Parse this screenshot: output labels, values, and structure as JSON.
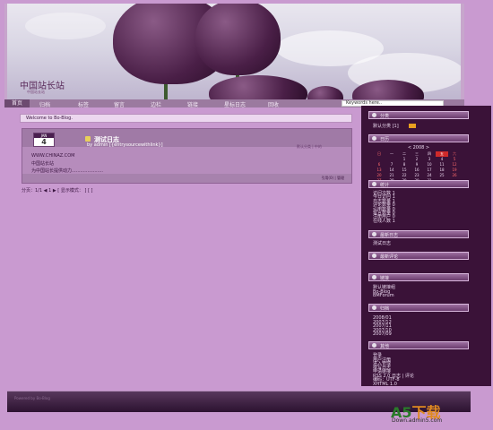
{
  "site": {
    "title": "中国站长站",
    "subtitle": "中国站长站"
  },
  "nav": {
    "home": "首页",
    "items": [
      "归档",
      "标签",
      "留言",
      "边栏",
      "链接",
      "星标日志",
      "回收"
    ],
    "search_placeholder": "Keywords here.."
  },
  "welcome": "Welcome to Bo-Blog.",
  "post": {
    "month": "JAN",
    "day": "4",
    "title": "测试日志",
    "author_prefix": "by",
    "author": "admin",
    "author_extra": "[{entrysourcewithlink}]",
    "meta": "默认分类 | 中的",
    "lines": [
      "WWW.CHINAZ.COM",
      "中国站长站",
      "为中国站长提供动力......................"
    ],
    "footer": "引用(0) | 管理"
  },
  "pager": "分页：1/1 ◀ 1 ▶ [ 显示模式： ] [ ]",
  "sidebar": {
    "widgets": [
      {
        "title": "分类",
        "lines": [
          "默认分类 [1]"
        ]
      },
      {
        "title": "日历",
        "lines": []
      },
      {
        "title": "统计",
        "lines": [
          "访问次数 1",
          "今日访问 1",
          "日志数量 1",
          "评论数量 0",
          "引用数量 0",
          "留言数量 0",
          "注册用户 0",
          "在线人数 1"
        ]
      },
      {
        "title": "最新日志",
        "lines": [
          "测试日志"
        ]
      },
      {
        "title": "最新评论",
        "lines": []
      },
      {
        "title": "链接",
        "lines": [
          "默认链接组",
          "Bo-Blog",
          "BMForum"
        ]
      },
      {
        "title": "归档",
        "lines": [
          "2008/01",
          "2007/12",
          "2007/11",
          "2007/10",
          "2007/09"
        ]
      },
      {
        "title": "其他",
        "lines": [
          "登录",
          "用户注册",
          "进入管理",
          "撰写日志",
          "申请链接",
          "RSS 2.0 日志 | 评论",
          "编码：UTF-8",
          "XHTML 1.0"
        ]
      }
    ],
    "calendar": {
      "head": "< 2008 > ",
      "weekdays": [
        "日",
        "一",
        "二",
        "三",
        "四",
        "五",
        "六"
      ],
      "weeks": [
        [
          "",
          "",
          "1",
          "2",
          "3",
          "4",
          "5"
        ],
        [
          "6",
          "7",
          "8",
          "9",
          "10",
          "11",
          "12"
        ],
        [
          "13",
          "14",
          "15",
          "16",
          "17",
          "18",
          "19"
        ],
        [
          "20",
          "21",
          "22",
          "23",
          "24",
          "25",
          "26"
        ],
        [
          "27",
          "28",
          "29",
          "30",
          "31",
          "",
          ""
        ]
      ]
    }
  },
  "footer": {
    "text": "Powered by Bo-Blog"
  },
  "watermark": {
    "logo_a": "A5",
    "logo_b": "下载",
    "url": "Down.admin5.com"
  },
  "colors": {
    "bg": "#c99ad0",
    "sidebar": "#3a1238",
    "accent": "#d02a2a"
  }
}
